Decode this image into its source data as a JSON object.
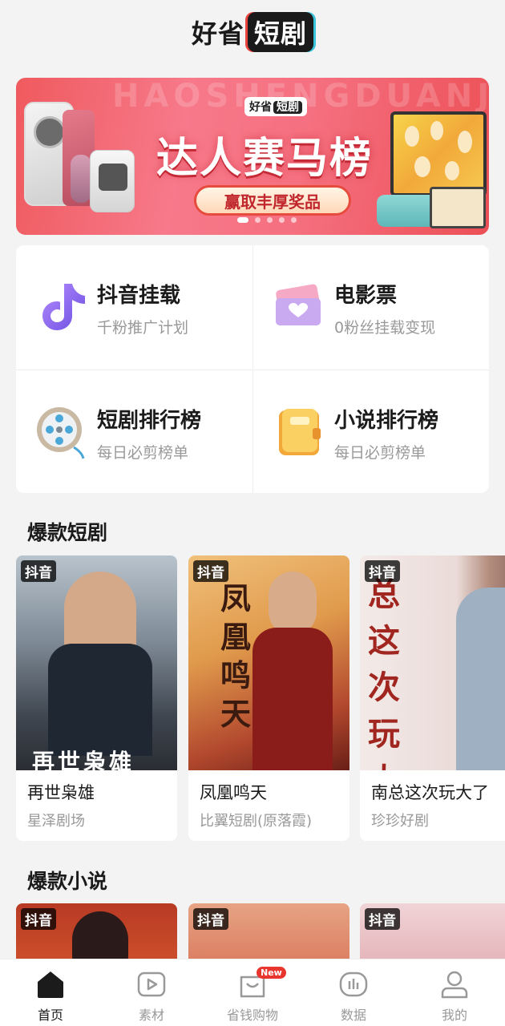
{
  "header": {
    "logo_text": "好省",
    "logo_box_text": "短剧"
  },
  "banner": {
    "watermark": "HAOSHENGDUANJU",
    "brand_tag": "好省",
    "brand_tag_box": "短剧",
    "title": "达人赛马榜",
    "button_label": "赢取丰厚奖品",
    "page_count": 5,
    "active_index": 0
  },
  "menu": [
    {
      "title": "抖音挂载",
      "subtitle": "千粉推广计划",
      "icon": "douyin-icon"
    },
    {
      "title": "电影票",
      "subtitle": "0粉丝挂载变现",
      "icon": "movie-ticket-icon"
    },
    {
      "title": "短剧排行榜",
      "subtitle": "每日必剪榜单",
      "icon": "film-reel-icon"
    },
    {
      "title": "小说排行榜",
      "subtitle": "每日必剪榜单",
      "icon": "book-icon"
    }
  ],
  "sections": {
    "drama_title": "爆款短剧",
    "novel_title": "爆款小说"
  },
  "dramas": [
    {
      "tag": "抖音",
      "name": "再世枭雄",
      "studio": "星泽剧场",
      "poster_text": "再世枭雄"
    },
    {
      "tag": "抖音",
      "name": "凤凰鸣天",
      "studio": "比翼短剧(原落霞)",
      "poster_text": "凤凰鸣天"
    },
    {
      "tag": "抖音",
      "name": "南总这次玩大了",
      "studio": "珍珍好剧",
      "poster_text": "总这次玩大"
    }
  ],
  "novels": [
    {
      "tag": "抖音"
    },
    {
      "tag": "抖音"
    },
    {
      "tag": "抖音"
    }
  ],
  "tabbar": {
    "items": [
      {
        "label": "首页",
        "icon": "home-icon",
        "active": true
      },
      {
        "label": "素材",
        "icon": "video-play-icon",
        "active": false
      },
      {
        "label": "省钱购物",
        "icon": "shopping-bag-icon",
        "active": false,
        "badge": "New"
      },
      {
        "label": "数据",
        "icon": "bar-chart-icon",
        "active": false
      },
      {
        "label": "我的",
        "icon": "user-icon",
        "active": false
      }
    ]
  }
}
